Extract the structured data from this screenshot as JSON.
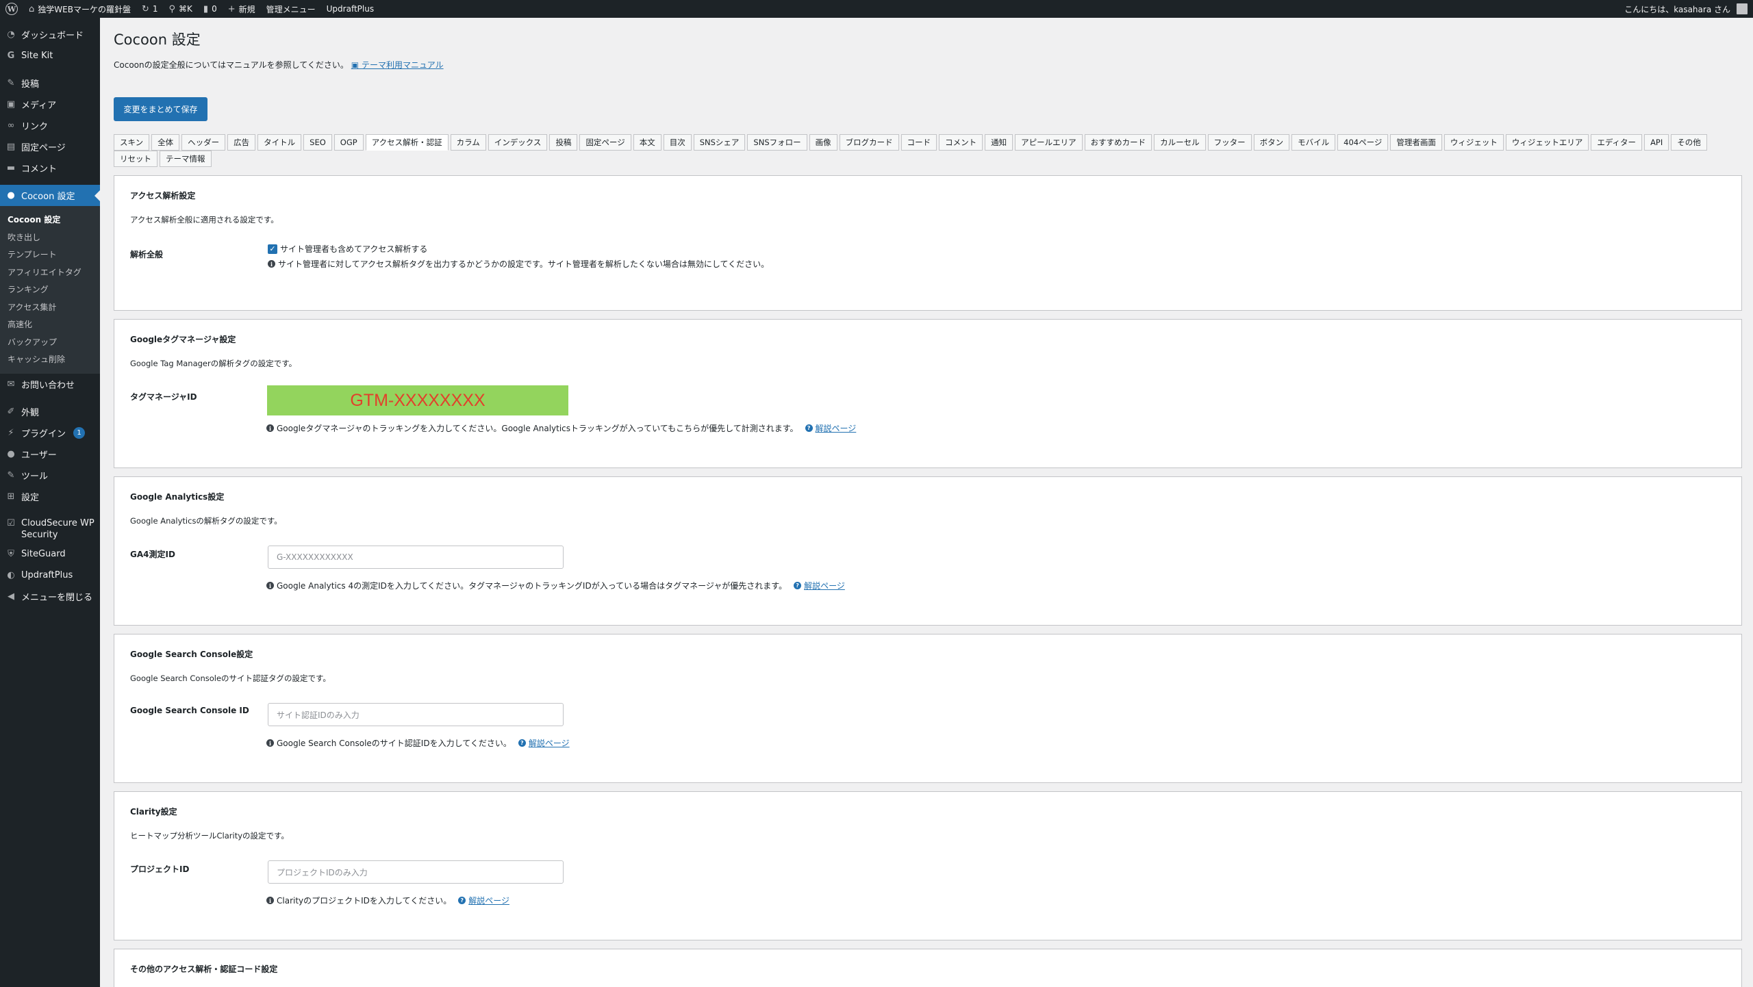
{
  "adminbar": {
    "site_name": "独学WEBマーケの羅針盤",
    "updates_count": "1",
    "search_shortcut": "⌘K",
    "comments_count": "0",
    "new_label": "新規",
    "admin_menu_label": "管理メニュー",
    "updraft_label": "UpdraftPlus",
    "greeting": "こんにちは、kasahara さん"
  },
  "sidebar": {
    "dashboard": "ダッシュボード",
    "sitekit": "Site Kit",
    "posts": "投稿",
    "media": "メディア",
    "links": "リンク",
    "pages": "固定ページ",
    "comments": "コメント",
    "cocoon": "Cocoon 設定",
    "submenu": [
      "Cocoon 設定",
      "吹き出し",
      "テンプレート",
      "アフィリエイトタグ",
      "ランキング",
      "アクセス集計",
      "高速化",
      "バックアップ",
      "キャッシュ削除"
    ],
    "contact": "お問い合わせ",
    "appearance": "外観",
    "plugins": "プラグイン",
    "plugins_badge": "1",
    "users": "ユーザー",
    "tools": "ツール",
    "settings": "設定",
    "cloudsecure": "CloudSecure WP Security",
    "siteguard": "SiteGuard",
    "updraftplus": "UpdraftPlus",
    "collapse": "メニューを閉じる"
  },
  "main": {
    "title": "Cocoon 設定",
    "intro_text": "Cocoonの設定全般についてはマニュアルを参照してください。",
    "intro_link": "テーマ利用マニュアル",
    "save_button": "変更をまとめて保存",
    "tabs": [
      "スキン",
      "全体",
      "ヘッダー",
      "広告",
      "タイトル",
      "SEO",
      "OGP",
      "アクセス解析・認証",
      "カラム",
      "インデックス",
      "投稿",
      "固定ページ",
      "本文",
      "目次",
      "SNSシェア",
      "SNSフォロー",
      "画像",
      "ブログカード",
      "コード",
      "コメント",
      "通知",
      "アピールエリア",
      "おすすめカード",
      "カルーセル",
      "フッター",
      "ボタン",
      "モバイル",
      "404ページ",
      "管理者画面",
      "ウィジェット",
      "ウィジェットエリア",
      "エディター",
      "API",
      "その他",
      "リセット",
      "テーマ情報"
    ],
    "active_tab": "アクセス解析・認証"
  },
  "panels": {
    "access": {
      "title": "アクセス解析設定",
      "desc": "アクセス解析全般に適用される設定です。",
      "label": "解析全般",
      "checkbox_label": "サイト管理者も含めてアクセス解析する",
      "checkbox_checked": true,
      "help": "サイト管理者に対してアクセス解析タグを出力するかどうかの設定です。サイト管理者を解析したくない場合は無効にしてください。"
    },
    "gtm": {
      "title": "Googleタグマネージャ設定",
      "desc": "Google Tag Managerの解析タグの設定です。",
      "label": "タグマネージャID",
      "value": "GTM-XXXXXXXX",
      "help": "Googleタグマネージャのトラッキングを入力してください。Google Analyticsトラッキングが入っていてもこちらが優先して計測されます。",
      "link": "解説ページ"
    },
    "ga": {
      "title": "Google Analytics設定",
      "desc": "Google Analyticsの解析タグの設定です。",
      "label": "GA4測定ID",
      "placeholder": "G-XXXXXXXXXXXX",
      "help": "Google Analytics 4の測定IDを入力してください。タグマネージャのトラッキングIDが入っている場合はタグマネージャが優先されます。",
      "link": "解説ページ"
    },
    "gsc": {
      "title": "Google Search Console設定",
      "desc": "Google Search Consoleのサイト認証タグの設定です。",
      "label": "Google Search Console ID",
      "placeholder": "サイト認証IDのみ入力",
      "help": "Google Search Consoleのサイト認証IDを入力してください。",
      "link": "解説ページ"
    },
    "clarity": {
      "title": "Clarity設定",
      "desc": "ヒートマップ分析ツールClarityの設定です。",
      "label": "プロジェクトID",
      "placeholder": "プロジェクトIDのみ入力",
      "help": "ClarityのプロジェクトIDを入力してください。",
      "link": "解説ページ"
    },
    "other": {
      "title": "その他のアクセス解析・認証コード設定"
    }
  }
}
